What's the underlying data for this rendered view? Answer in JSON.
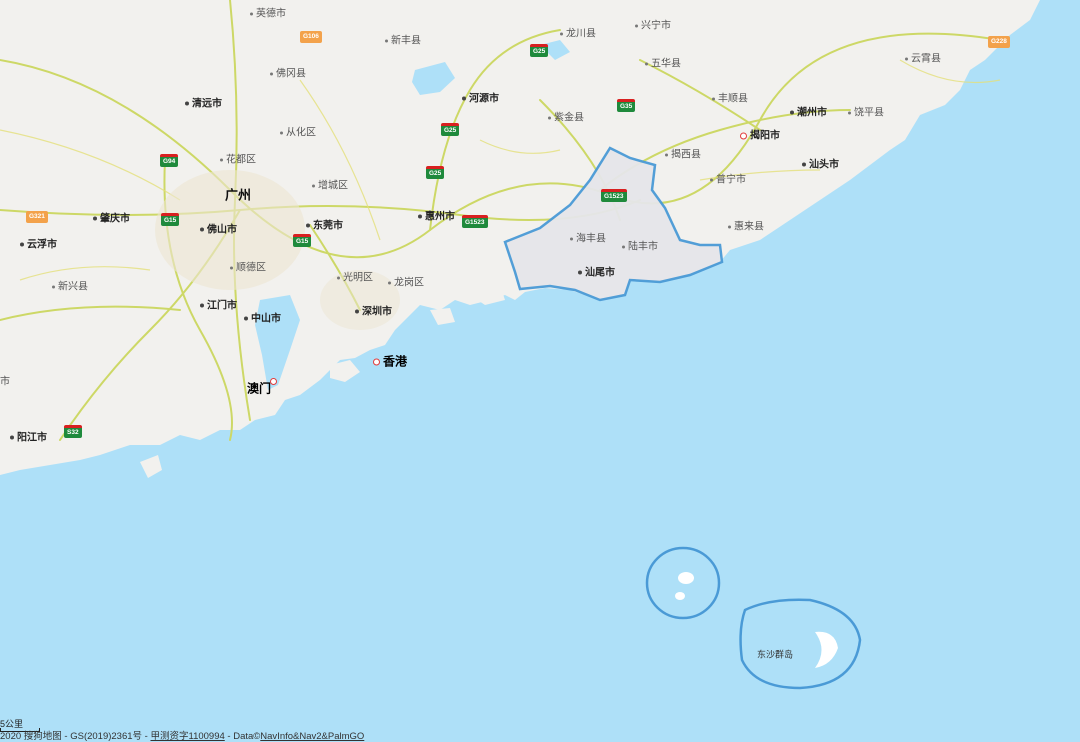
{
  "labels": {
    "yingde": "英德市",
    "xinfeng": "新丰县",
    "longchuan": "龙川县",
    "xingning": "兴宁市",
    "fogang": "佛冈县",
    "wuhua": "五华县",
    "yunxiao": "云霄县",
    "qingyuan": "清远市",
    "heyuan": "河源市",
    "fengshun": "丰顺县",
    "chaozhou": "潮州市",
    "raoping": "饶平县",
    "conghua": "从化区",
    "zijin": "紫金县",
    "jieyang": "揭阳市",
    "huadu": "花都区",
    "jiexi": "揭西县",
    "shantou": "汕头市",
    "guangzhou": "广州",
    "zengcheng": "增城区",
    "puning": "普宁市",
    "zhaoqing": "肇庆市",
    "foshan": "佛山市",
    "dongguan": "东莞市",
    "huizhou": "惠州市",
    "huilai": "惠来县",
    "yunfu": "云浮市",
    "haifeng": "海丰县",
    "lufeng": "陆丰市",
    "shunde": "顺德区",
    "shanwei": "汕尾市",
    "guangming": "光明区",
    "longgang": "龙岗区",
    "xinxing": "新兴县",
    "jiangmen": "江门市",
    "shenzhen": "深圳市",
    "zhongshan": "中山市",
    "hongkong": "香港",
    "macao": "澳门",
    "yangjiang": "阳江市",
    "dongsha": "东沙群岛",
    "edge_left": "市"
  },
  "shields": {
    "g106": "G106",
    "g25_a": "G25",
    "g25_b": "G25",
    "g25_c": "G25",
    "g35": "G35",
    "g228": "G228",
    "g94": "G94",
    "g15_a": "G15",
    "g15_b": "G15",
    "g1523_a": "G1523",
    "g1523_b": "G1523",
    "g321": "G321",
    "s32": "S32"
  },
  "scale": {
    "label": "5公里"
  },
  "footer": {
    "copyright": "2020 搜狗地图 - GS(2019)2361号 - ",
    "survey_link": "甲测资字1100994",
    "data_prefix": " - Data©",
    "data_link": "NavInfo&Nav2&PalmGO"
  },
  "colors": {
    "sea": "#aee0f8",
    "land": "#f2f1ee",
    "highlight_fill": "#e6e6ea",
    "highlight_border": "#4a9ad6",
    "highway": "#d8e27a",
    "shield_green": "#1f8a3c",
    "shield_red": "#d82020"
  }
}
